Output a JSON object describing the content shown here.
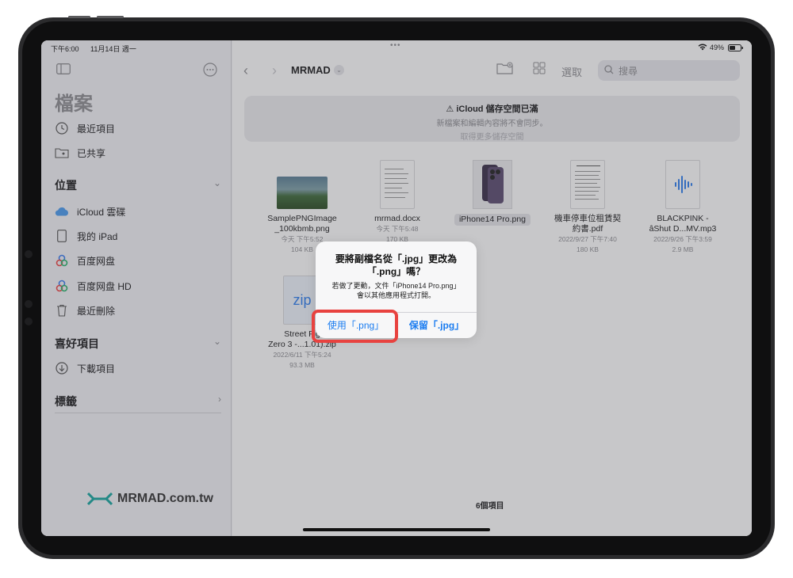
{
  "status_bar": {
    "time": "下午6:00",
    "date": "11月14日 週一",
    "battery": "49%"
  },
  "sidebar": {
    "title": "檔案",
    "top_items": [
      {
        "label": "最近項目"
      },
      {
        "label": "已共享"
      }
    ],
    "locations_header": "位置",
    "locations": [
      {
        "label": "iCloud 雲碟"
      },
      {
        "label": "我的 iPad"
      },
      {
        "label": "百度网盘"
      },
      {
        "label": "百度网盘 HD"
      },
      {
        "label": "最近刪除"
      }
    ],
    "favorites_header": "喜好項目",
    "favorites": [
      {
        "label": "下載項目"
      }
    ],
    "tags_header": "標籤"
  },
  "logo": {
    "text": "MRMAD.com.tw",
    "color": "#16a6a0"
  },
  "main": {
    "folder_title": "MRMAD",
    "select_label": "選取",
    "search_placeholder": "搜尋",
    "banner": {
      "title": "iCloud 儲存空間已滿",
      "subtitle": "新檔案和編輯內容將不會同步。",
      "link": "取得更多儲存空間"
    },
    "files": [
      {
        "name1": "SamplePNGImage",
        "name2": "_100kbmb.png",
        "date": "今天 下午5:52",
        "size": "104 KB"
      },
      {
        "name1": "mrmad.docx",
        "name2": "",
        "date": "今天 下午5:48",
        "size": "170 KB"
      },
      {
        "name1": "iPhone14 Pro.png",
        "name2": "",
        "date": "",
        "size": ""
      },
      {
        "name1": "機車停車位租賃契",
        "name2": "約書.pdf",
        "date": "2022/9/27 下午7:40",
        "size": "180 KB"
      },
      {
        "name1": "BLACKPINK -",
        "name2": "âShut D...MV.mp3",
        "date": "2022/9/26 下午3:59",
        "size": "2.9 MB"
      },
      {
        "name1": "Street Fig",
        "name2": "Zero 3 -...1.01).zip",
        "date": "2022/6/11 下午5:24",
        "size": "93.3 MB"
      }
    ],
    "zip_label": "zip",
    "item_count": "6個項目"
  },
  "alert": {
    "title": "要將副檔名從「.jpg」更改為「.png」嗎？",
    "message": "若做了更動，文件「iPhone14 Pro.png」會以其他應用程式打開。",
    "use_button": "使用「.png」",
    "keep_button": "保留「.jpg」"
  }
}
